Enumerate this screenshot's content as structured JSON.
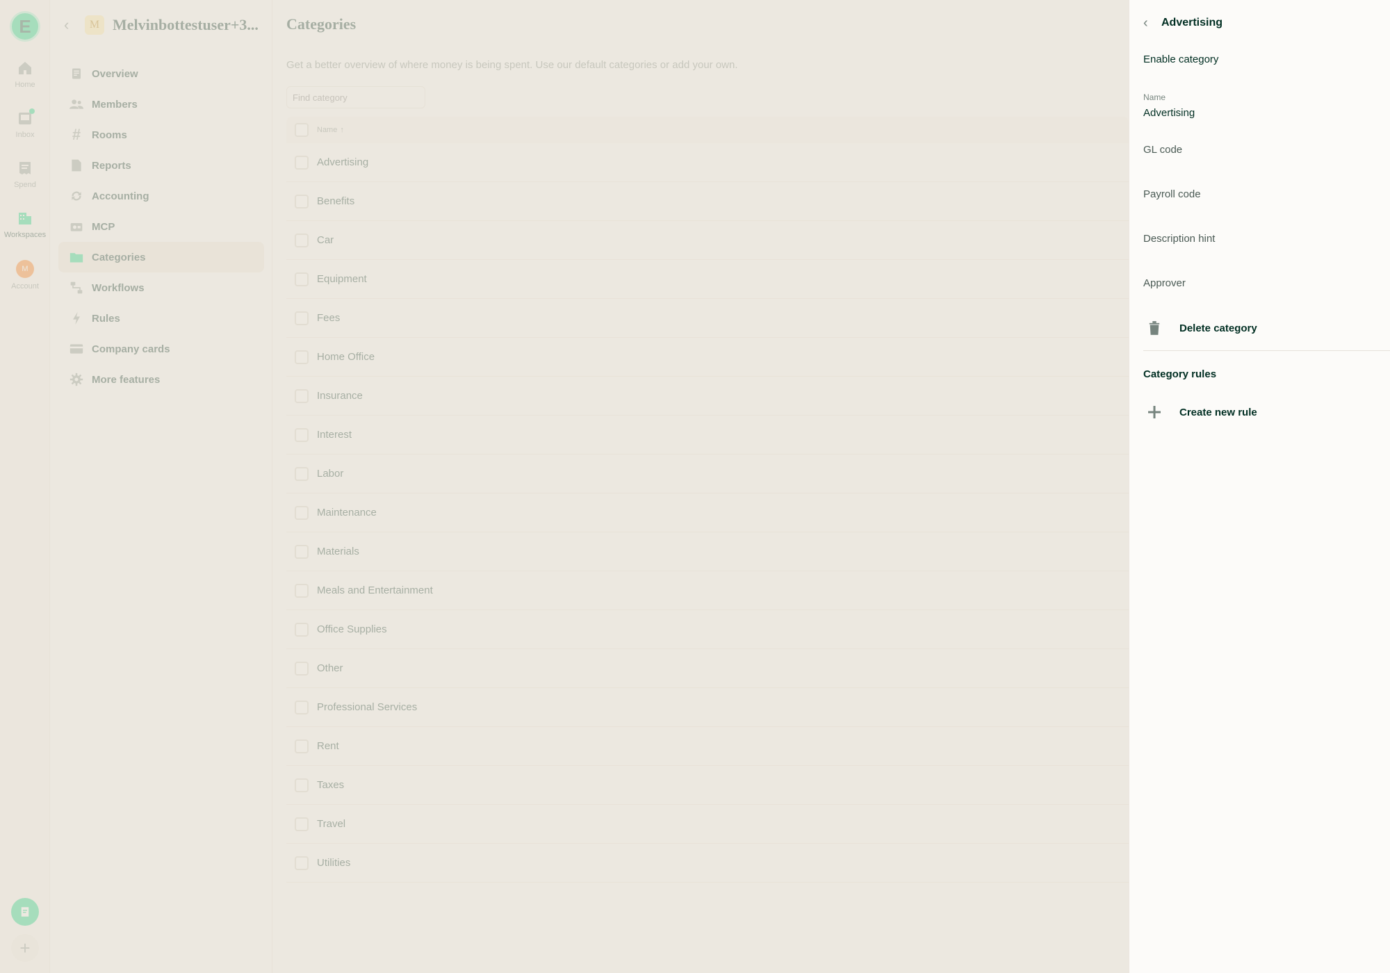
{
  "rail": {
    "items": [
      {
        "label": "Home",
        "icon": "home-icon"
      },
      {
        "label": "Inbox",
        "icon": "inbox-icon"
      },
      {
        "label": "Spend",
        "icon": "receipt-icon"
      },
      {
        "label": "Workspaces",
        "icon": "building-icon"
      },
      {
        "label": "Account",
        "icon": "avatar",
        "avatar_letter": "M"
      }
    ]
  },
  "workspace": {
    "avatar_letter": "M",
    "name": "Melvinbottestuser+3...",
    "menu": [
      {
        "label": "Overview",
        "icon": "document-icon"
      },
      {
        "label": "Members",
        "icon": "users-icon"
      },
      {
        "label": "Rooms",
        "icon": "hashtag-icon"
      },
      {
        "label": "Reports",
        "icon": "file-icon"
      },
      {
        "label": "Accounting",
        "icon": "sync-icon"
      },
      {
        "label": "MCP",
        "icon": "mcp-icon"
      },
      {
        "label": "Categories",
        "icon": "folder-icon",
        "active": true
      },
      {
        "label": "Workflows",
        "icon": "workflow-icon"
      },
      {
        "label": "Rules",
        "icon": "bolt-icon"
      },
      {
        "label": "Company cards",
        "icon": "card-icon"
      },
      {
        "label": "More features",
        "icon": "gear-icon"
      }
    ]
  },
  "main": {
    "title": "Categories",
    "description": "Get a better overview of where money is being spent. Use our default categories or add your own.",
    "search_placeholder": "Find category",
    "column_name": "Name",
    "categories": [
      "Advertising",
      "Benefits",
      "Car",
      "Equipment",
      "Fees",
      "Home Office",
      "Insurance",
      "Interest",
      "Labor",
      "Maintenance",
      "Materials",
      "Meals and Entertainment",
      "Office Supplies",
      "Other",
      "Professional Services",
      "Rent",
      "Taxes",
      "Travel",
      "Utilities"
    ]
  },
  "panel": {
    "title": "Advertising",
    "enable_label": "Enable category",
    "name_label": "Name",
    "name_value": "Advertising",
    "gl_code": "GL code",
    "payroll_code": "Payroll code",
    "description_hint": "Description hint",
    "approver": "Approver",
    "delete_label": "Delete category",
    "rules_section": "Category rules",
    "create_rule": "Create new rule"
  },
  "colors": {
    "accent": "#03d47c",
    "text": "#002e22",
    "muted": "#76847e",
    "background": "#fcfbf9"
  }
}
